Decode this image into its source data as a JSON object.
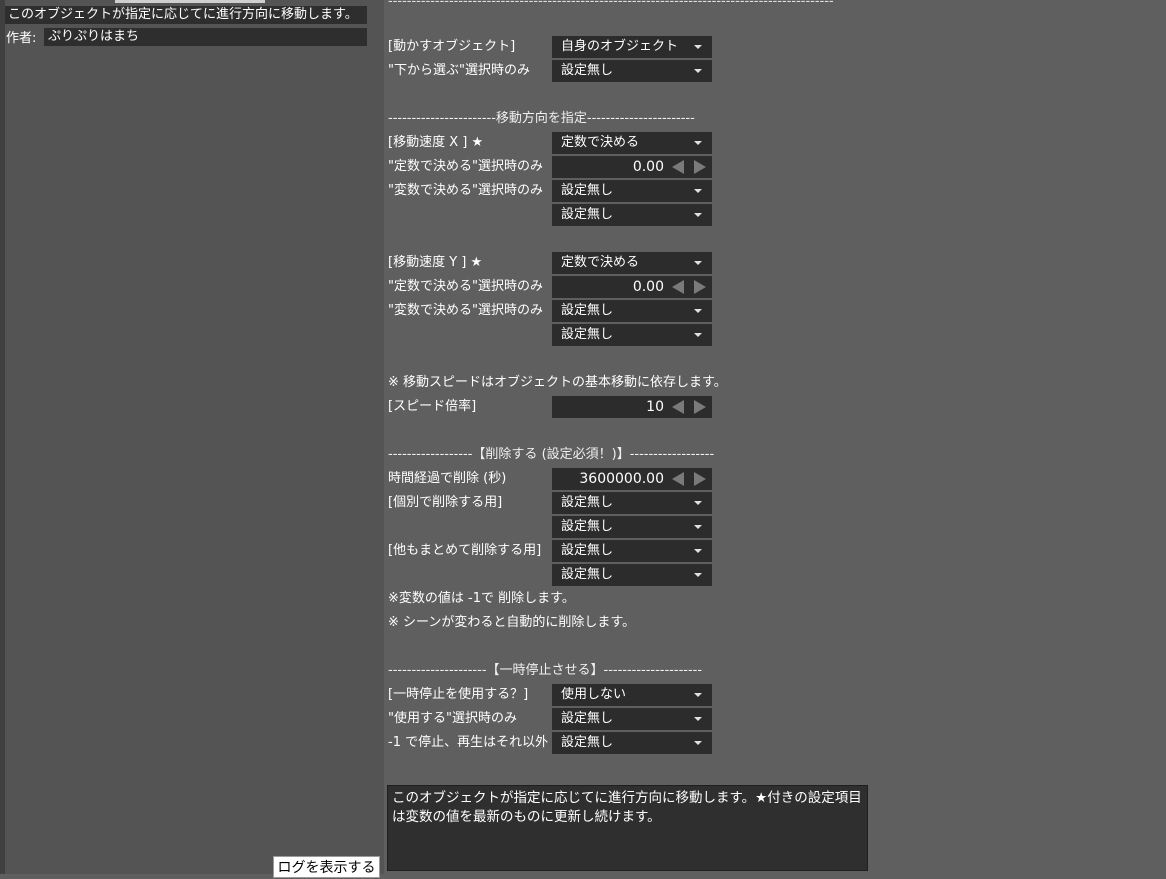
{
  "left_panel": {
    "description": "このオブジェクトが指定に応じてに進行方向に移動します。",
    "author_label": "作者:",
    "author_name": "ぷりぷりはまち",
    "log_button": "ログを表示する"
  },
  "main": {
    "top_dashes": "-----------------------------------------------------------------------------------------------",
    "rows": {
      "object_label": "[動かすオブジェクト]",
      "object_value": "自身のオブジェクト",
      "from_below_label": "\"下から選ぶ\"選択時のみ",
      "from_below_value": "設定無し",
      "direction_sep": "-----------------------移動方向を指定-----------------------",
      "speed_x_label": "[移動速度 X ] ★",
      "speed_x_mode": "定数で決める",
      "speed_x_const_label": "\"定数で決める\"選択時のみ",
      "speed_x_const": "0.00",
      "speed_x_var_label": "\"変数で決める\"選択時のみ",
      "speed_x_var1": "設定無し",
      "speed_x_var2": "設定無し",
      "speed_y_label": "[移動速度 Y ] ★",
      "speed_y_mode": "定数で決める",
      "speed_y_const_label": "\"定数で決める\"選択時のみ",
      "speed_y_const": "0.00",
      "speed_y_var_label": "\"変数で決める\"選択時のみ",
      "speed_y_var1": "設定無し",
      "speed_y_var2": "設定無し",
      "speed_note": "※ 移動スピードはオブジェクトの基本移動に依存します。",
      "speed_rate_label": "[スピード倍率]",
      "speed_rate": "10",
      "delete_sep": "------------------【削除する (設定必須！)】------------------",
      "time_delete_label": "時間経過で削除 (秒)",
      "time_delete": "3600000.00",
      "individual_label": "[個別で削除する用]",
      "individual_1": "設定無し",
      "individual_2": "設定無し",
      "group_label": "[他もまとめて削除する用]",
      "group_1": "設定無し",
      "group_2": "設定無し",
      "delete_note1": "※変数の値は -1で 削除します。",
      "delete_note2": "※ シーンが変わると自動的に削除します。",
      "pause_sep": "---------------------【一時停止させる】---------------------",
      "pause_use_label": "[一時停止を使用する？]",
      "pause_use": "使用しない",
      "pause_sel_label": "\"使用する\"選択時のみ",
      "pause_sel": "設定無し",
      "pause_var_label": "-1 で停止、再生はそれ以外",
      "pause_var": "設定無し"
    },
    "help_text": "このオブジェクトが指定に応じてに進行方向に移動します。★付きの設定項目は変数の値を最新のものに更新し続けます。"
  }
}
